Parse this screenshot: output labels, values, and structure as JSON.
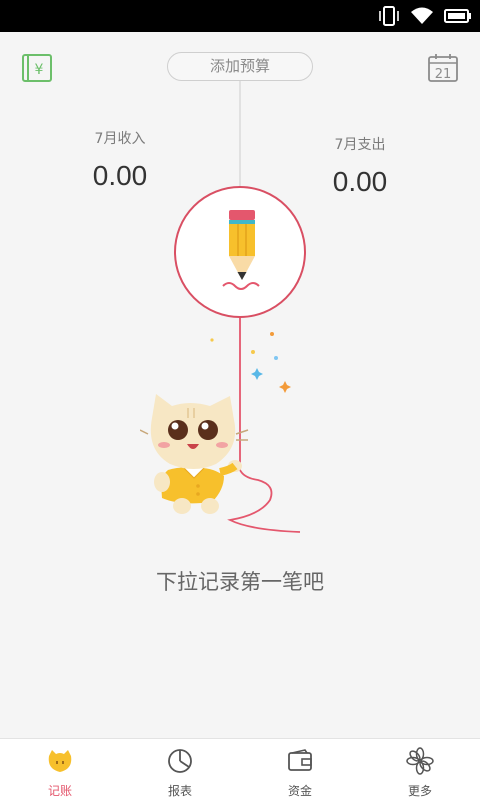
{
  "status_bar": {
    "icons": [
      "vibrate-icon",
      "wifi-icon",
      "battery-icon"
    ]
  },
  "header": {
    "budget_button_label": "添加预算",
    "calendar_day": "21",
    "ledger_symbol": "¥"
  },
  "stats": {
    "income_label": "7月收入",
    "income_value": "0.00",
    "expense_label": "7月支出",
    "expense_value": "0.00"
  },
  "hint": "下拉记录第一笔吧",
  "tabs": [
    {
      "label": "记账",
      "icon": "cat-face-icon",
      "active": true
    },
    {
      "label": "报表",
      "icon": "pie-chart-icon",
      "active": false
    },
    {
      "label": "资金",
      "icon": "wallet-icon",
      "active": false
    },
    {
      "label": "更多",
      "icon": "flower-icon",
      "active": false
    }
  ],
  "colors": {
    "accent": "#e4576d",
    "header_green": "#6cbf6a",
    "cat_yellow": "#f7c02c"
  }
}
